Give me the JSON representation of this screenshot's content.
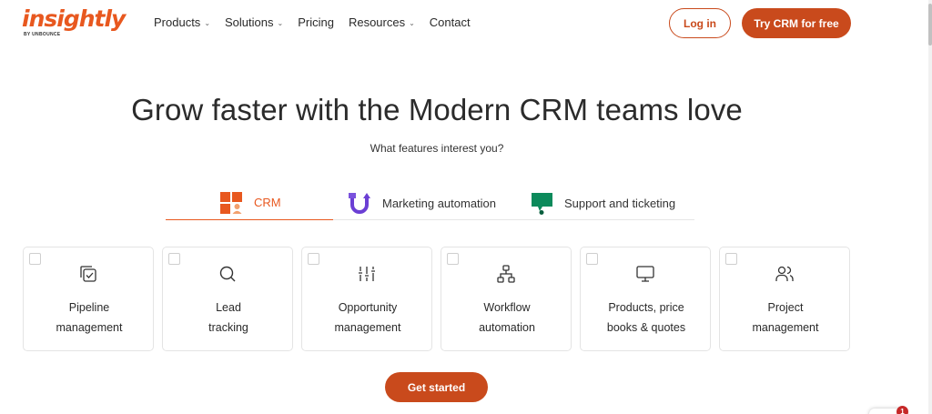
{
  "brand": {
    "logo_text": "insightly",
    "logo_sub": "BY UNBOUNCE",
    "accent": "#e8581f",
    "button_color": "#c94a1c"
  },
  "nav": {
    "items": [
      {
        "label": "Products",
        "has_dropdown": true
      },
      {
        "label": "Solutions",
        "has_dropdown": true
      },
      {
        "label": "Pricing",
        "has_dropdown": false
      },
      {
        "label": "Resources",
        "has_dropdown": true
      },
      {
        "label": "Contact",
        "has_dropdown": false
      }
    ],
    "login_label": "Log in",
    "try_label": "Try CRM for free"
  },
  "hero": {
    "title": "Grow faster with the Modern CRM teams love",
    "subtitle": "What features interest you?"
  },
  "tabs": [
    {
      "label": "CRM",
      "icon": "crm-grid-icon",
      "active": true
    },
    {
      "label": "Marketing automation",
      "icon": "marketing-automation-icon",
      "active": false
    },
    {
      "label": "Support and ticketing",
      "icon": "support-ticketing-icon",
      "active": false
    }
  ],
  "features": [
    {
      "label": "Pipeline\nmanagement",
      "icon": "pipeline-icon",
      "checked": false
    },
    {
      "label": "Lead\ntracking",
      "icon": "search-icon",
      "checked": false
    },
    {
      "label": "Opportunity\nmanagement",
      "icon": "sliders-icon",
      "checked": false
    },
    {
      "label": "Workflow\nautomation",
      "icon": "workflow-icon",
      "checked": false
    },
    {
      "label": "Products, price\nbooks & quotes",
      "icon": "monitor-icon",
      "checked": false
    },
    {
      "label": "Project\nmanagement",
      "icon": "users-icon",
      "checked": false
    }
  ],
  "cta": {
    "label": "Get started"
  },
  "chat": {
    "badge_count": "1"
  }
}
